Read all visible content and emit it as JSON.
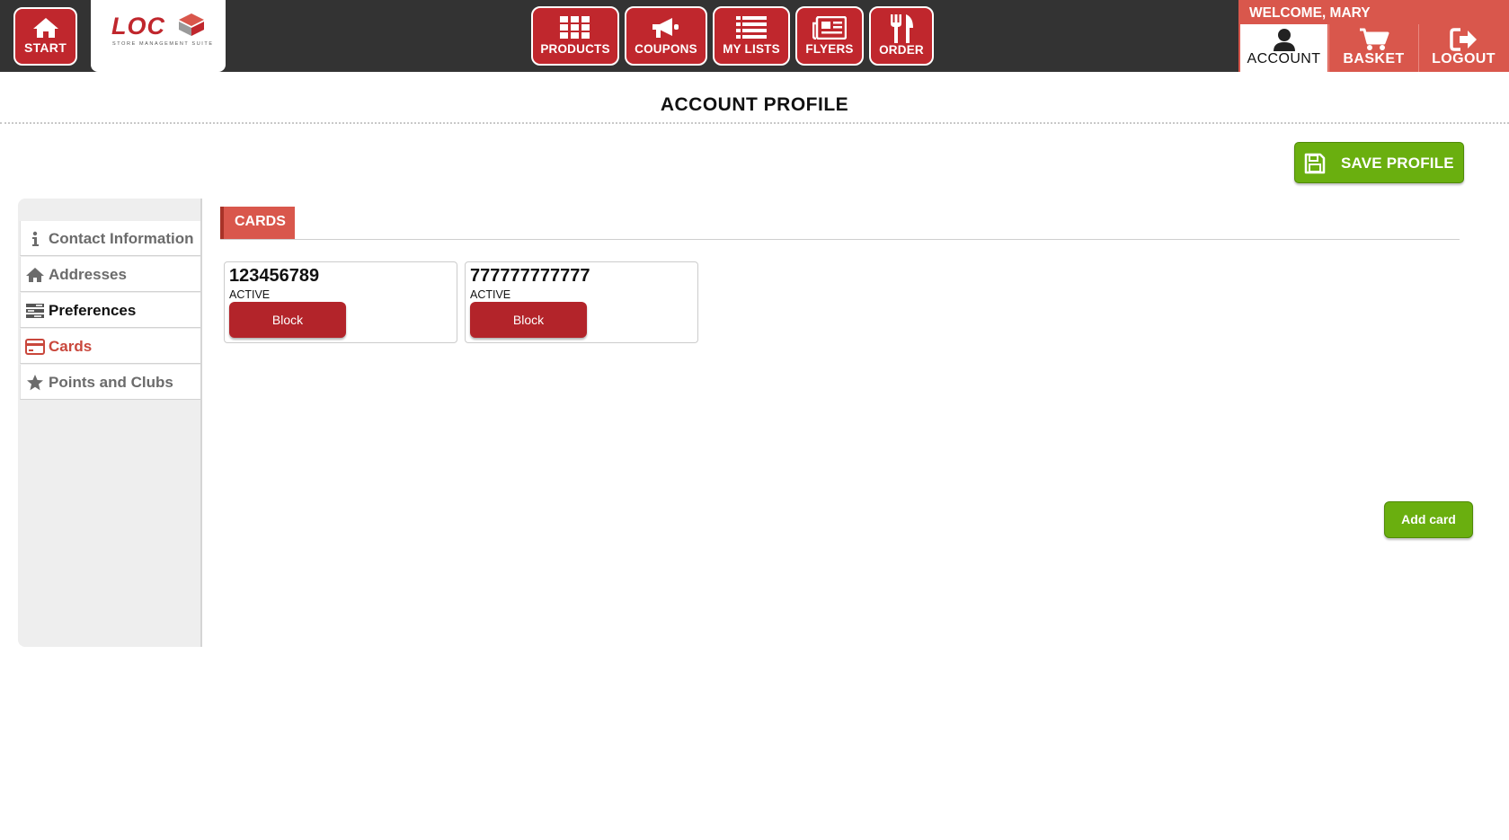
{
  "header": {
    "start_label": "START",
    "logo_text": "LOC",
    "logo_subtitle": "STORE MANAGEMENT SUITE",
    "nav": [
      {
        "label": "PRODUCTS",
        "icon": "grid-icon"
      },
      {
        "label": "COUPONS",
        "icon": "megaphone-icon"
      },
      {
        "label": "MY LISTS",
        "icon": "list-icon"
      },
      {
        "label": "FLYERS",
        "icon": "newspaper-icon"
      },
      {
        "label": "ORDER",
        "icon": "utensils-icon"
      }
    ],
    "welcome": "WELCOME, MARY",
    "account_tabs": [
      {
        "label": "ACCOUNT",
        "icon": "user-icon",
        "active": true
      },
      {
        "label": "BASKET",
        "icon": "cart-icon",
        "active": false
      },
      {
        "label": "LOGOUT",
        "icon": "logout-icon",
        "active": false
      }
    ]
  },
  "page": {
    "title": "ACCOUNT PROFILE",
    "save_label": "SAVE PROFILE"
  },
  "sidebar": {
    "items": [
      {
        "label": "Contact Information",
        "icon": "info-icon",
        "state": "default"
      },
      {
        "label": "Addresses",
        "icon": "home-icon",
        "state": "default"
      },
      {
        "label": "Preferences",
        "icon": "preferences-icon",
        "state": "dark"
      },
      {
        "label": "Cards",
        "icon": "credit-card-icon",
        "state": "active"
      },
      {
        "label": "Points and Clubs",
        "icon": "star-icon",
        "state": "default"
      }
    ]
  },
  "cards": {
    "section_label": "CARDS",
    "items": [
      {
        "number": "123456789",
        "status": "ACTIVE",
        "action": "Block"
      },
      {
        "number": "777777777777",
        "status": "ACTIVE",
        "action": "Block"
      }
    ],
    "add_label": "Add card"
  },
  "colors": {
    "brand_red": "#c0272d",
    "accent_salmon": "#d9574c",
    "action_green": "#6aaf0f",
    "topbar": "#333333"
  }
}
